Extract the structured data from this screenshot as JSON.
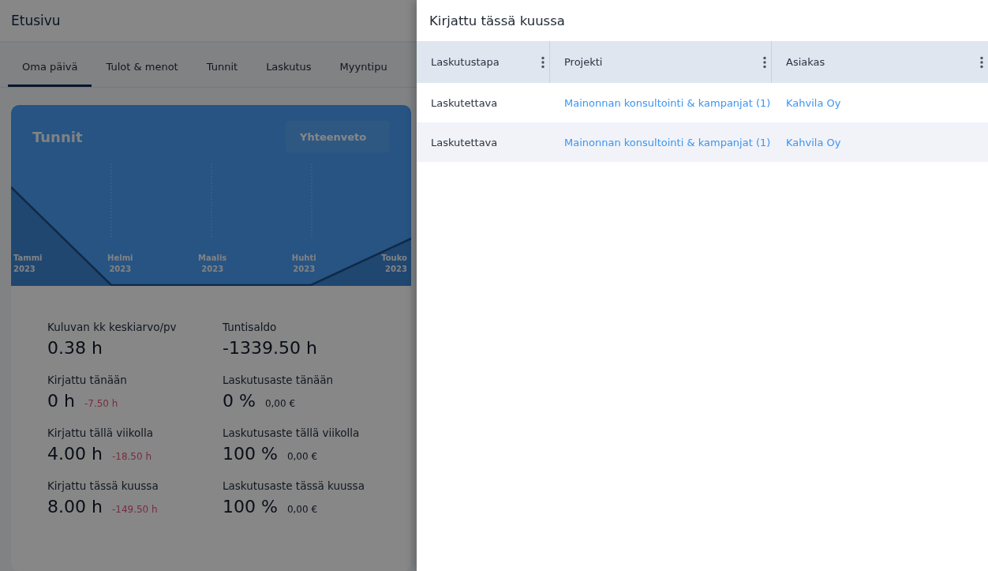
{
  "header": {
    "title": "Etusivu"
  },
  "tabs": [
    {
      "label": "Oma päivä",
      "selected": true
    },
    {
      "label": "Tulot & menot",
      "selected": false
    },
    {
      "label": "Tunnit",
      "selected": false
    },
    {
      "label": "Laskutus",
      "selected": false
    },
    {
      "label": "Myyntipu",
      "selected": false
    }
  ],
  "hours_card": {
    "title": "Tunnit",
    "view_select": {
      "value": "Yhteenveto"
    },
    "months": [
      {
        "month": "Tammi",
        "year": "2023"
      },
      {
        "month": "Helmi",
        "year": "2023"
      },
      {
        "month": "Maalis",
        "year": "2023"
      },
      {
        "month": "Huhti",
        "year": "2023"
      },
      {
        "month": "Touko",
        "year": "2023"
      }
    ]
  },
  "stats": [
    {
      "label": "Kuluvan kk keskiarvo/pv",
      "value": "0.38 h"
    },
    {
      "label": "Tuntisaldo",
      "value": "-1339.50 h"
    },
    {
      "label": "Kirjattu tänään",
      "value": "0 h",
      "note": {
        "kind": "deficit",
        "text": "-7.50 h"
      }
    },
    {
      "label": "Laskutusaste tänään",
      "value": "0 %",
      "note": {
        "kind": "amount",
        "text": "0,00 €"
      }
    },
    {
      "label": "Kirjattu tällä viikolla",
      "value": "4.00 h",
      "note": {
        "kind": "deficit",
        "text": "-18.50 h"
      }
    },
    {
      "label": "Laskutusaste tällä viikolla",
      "value": "100 %",
      "note": {
        "kind": "amount",
        "text": "0,00 €"
      }
    },
    {
      "label": "Kirjattu tässä kuussa",
      "value": "8.00 h",
      "note": {
        "kind": "deficit",
        "text": "-149.50 h"
      }
    },
    {
      "label": "Laskutusaste tässä kuussa",
      "value": "100 %",
      "note": {
        "kind": "amount",
        "text": "0,00 €"
      }
    }
  ],
  "drawer": {
    "title": "Kirjattu tässä kuussa",
    "columns": [
      {
        "label": "Laskutustapa",
        "link": false
      },
      {
        "label": "Projekti",
        "link": true
      },
      {
        "label": "Asiakas",
        "link": true
      }
    ],
    "rows": [
      [
        "Laskutettava",
        "Mainonnan konsultointi & kampanjat (1)",
        "Kahvila Oy"
      ],
      [
        "Laskutettava",
        "Mainonnan konsultointi & kampanjat (1)",
        "Kahvila Oy"
      ]
    ]
  }
}
